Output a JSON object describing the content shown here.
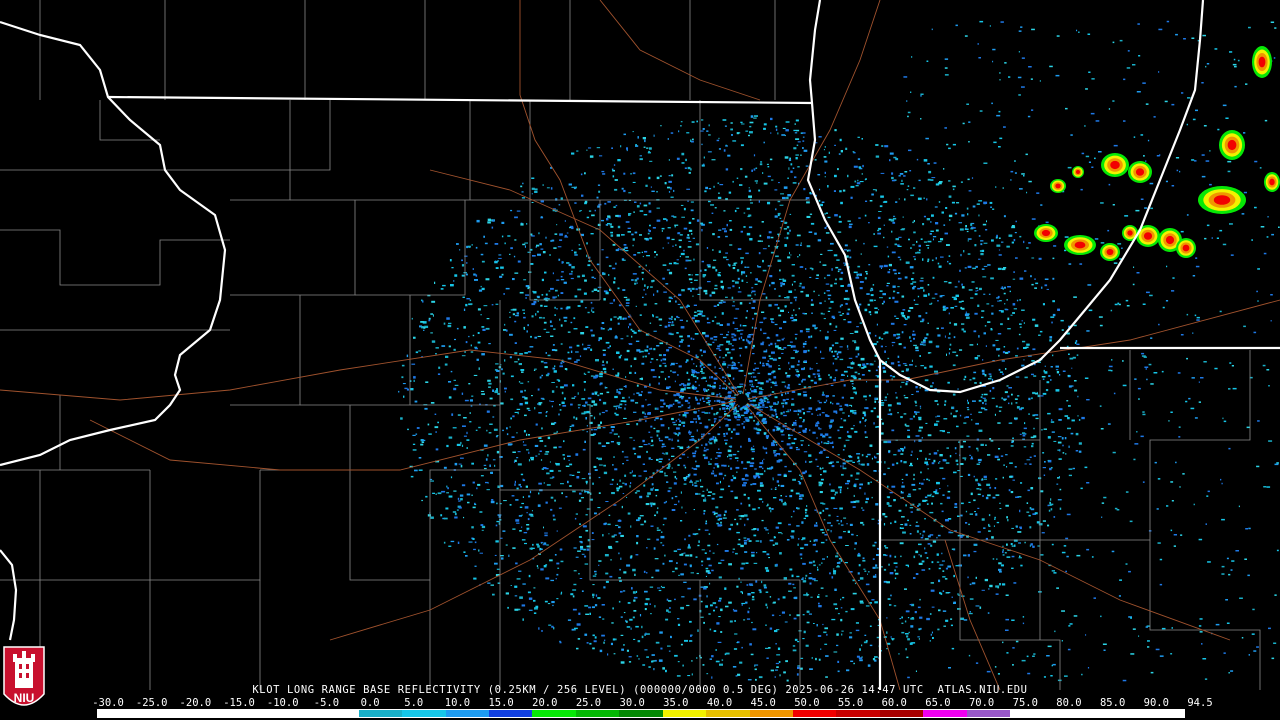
{
  "product_caption": "KLOT LONG RANGE BASE REFLECTIVITY (0.25KM / 256 LEVEL) (000000/0000 0.5 DEG) 2025-06-26 14:47 UTC  ATLAS.NIU.EDU",
  "logo_text": "NIU",
  "colorbar": {
    "ticks": [
      "-30.0",
      "-25.0",
      "-20.0",
      "-15.0",
      "-10.0",
      "-5.0",
      "0.0",
      "5.0",
      "10.0",
      "15.0",
      "20.0",
      "25.0",
      "30.0",
      "35.0",
      "40.0",
      "45.0",
      "50.0",
      "55.0",
      "60.0",
      "65.0",
      "70.0",
      "75.0",
      "80.0",
      "85.0",
      "90.0",
      "94.5"
    ],
    "colors": [
      "#ffffff",
      "#ffffff",
      "#ffffff",
      "#ffffff",
      "#ffffff",
      "#ffffff",
      "#19b0c8",
      "#16c6e8",
      "#1e9cf0",
      "#1240e0",
      "#06e806",
      "#04b804",
      "#048804",
      "#f2f200",
      "#e6c000",
      "#f09600",
      "#f20000",
      "#c80000",
      "#a80000",
      "#f000f0",
      "#9858c8",
      "#ffffff",
      "#ffffff",
      "#ffffff",
      "#ffffff"
    ]
  },
  "colors": {
    "background": "#000000",
    "county_lines": "#8a8a8a",
    "state_lines": "#ffffff",
    "roads": "#a0522d",
    "radar_site": "#000000"
  }
}
